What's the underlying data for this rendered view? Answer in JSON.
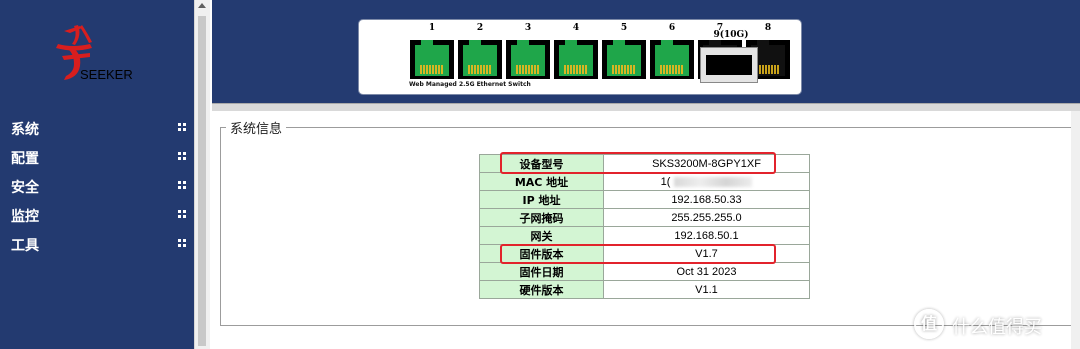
{
  "sidebar": {
    "logo_text": "SEEKER",
    "items": [
      {
        "label": "系统"
      },
      {
        "label": "配置"
      },
      {
        "label": "安全"
      },
      {
        "label": "监控"
      },
      {
        "label": "工具"
      }
    ]
  },
  "switch_panel": {
    "ports": [
      {
        "label": "1",
        "status": "up",
        "color": "#1fa64a"
      },
      {
        "label": "2",
        "status": "up",
        "color": "#1fa64a"
      },
      {
        "label": "3",
        "status": "up",
        "color": "#1fa64a"
      },
      {
        "label": "4",
        "status": "up",
        "color": "#1fa64a"
      },
      {
        "label": "5",
        "status": "up",
        "color": "#1fa64a"
      },
      {
        "label": "6",
        "status": "up",
        "color": "#1fa64a"
      },
      {
        "label": "7",
        "status": "down",
        "color": "#111111"
      },
      {
        "label": "8",
        "status": "down",
        "color": "#111111"
      }
    ],
    "caption": "Web Managed 2.5G Ethernet Switch",
    "sfp_label": "9(10G)"
  },
  "system_info": {
    "legend": "系统信息",
    "rows": [
      {
        "key": "设备型号",
        "value": "SKS3200M-8GPY1XF",
        "highlighted": true
      },
      {
        "key": "MAC 地址",
        "value": "1(",
        "redacted": true
      },
      {
        "key": "IP 地址",
        "value": "192.168.50.33"
      },
      {
        "key": "子网掩码",
        "value": "255.255.255.0"
      },
      {
        "key": "网关",
        "value": "192.168.50.1"
      },
      {
        "key": "固件版本",
        "value": "V1.7",
        "highlighted": true
      },
      {
        "key": "固件日期",
        "value": "Oct 31 2023"
      },
      {
        "key": "硬件版本",
        "value": "V1.1"
      }
    ]
  },
  "colors": {
    "nav_bg": "#233a70",
    "banner_bg": "#243b71",
    "key_cell_bg": "#d3f5d3",
    "highlight": "#e2232c"
  },
  "watermark": {
    "badge": "值",
    "text": "什么值得买"
  }
}
